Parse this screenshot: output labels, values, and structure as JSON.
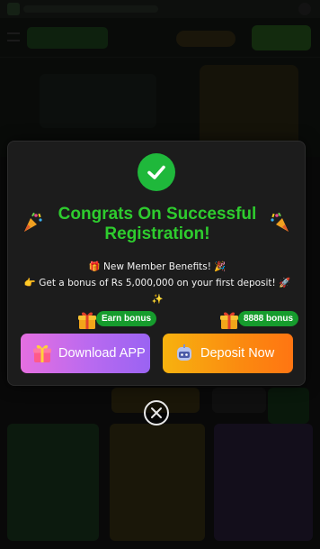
{
  "modal": {
    "title": "Congrats On Successful Registration!",
    "benefits_line": "🎁 New Member Benefits! 🎉",
    "bonus_line": "👉 Get a bonus of Rs 5,000,000 on your first deposit! 🚀",
    "bonus_line_tail": "✨",
    "download_button_label": "Download APP",
    "download_badge": "Earn bonus",
    "deposit_button_label": "Deposit Now",
    "deposit_badge": "8888 bonus"
  },
  "icons": {
    "success": "check-circle-icon",
    "confetti": "party-popper-icon",
    "gift": "gift-icon",
    "download": "gift-box-icon",
    "deposit": "wallet-robot-icon",
    "close": "close-circle-icon"
  },
  "colors": {
    "accent_green": "#2ecc2e",
    "success_circle": "#1fb83b",
    "badge_green": "#169c2d",
    "download_gradient_start": "#e56fe0",
    "download_gradient_end": "#9a63f2",
    "deposit_gradient_start": "#f7b20f",
    "deposit_gradient_end": "#ff7512",
    "modal_bg": "#1c1c1c"
  }
}
